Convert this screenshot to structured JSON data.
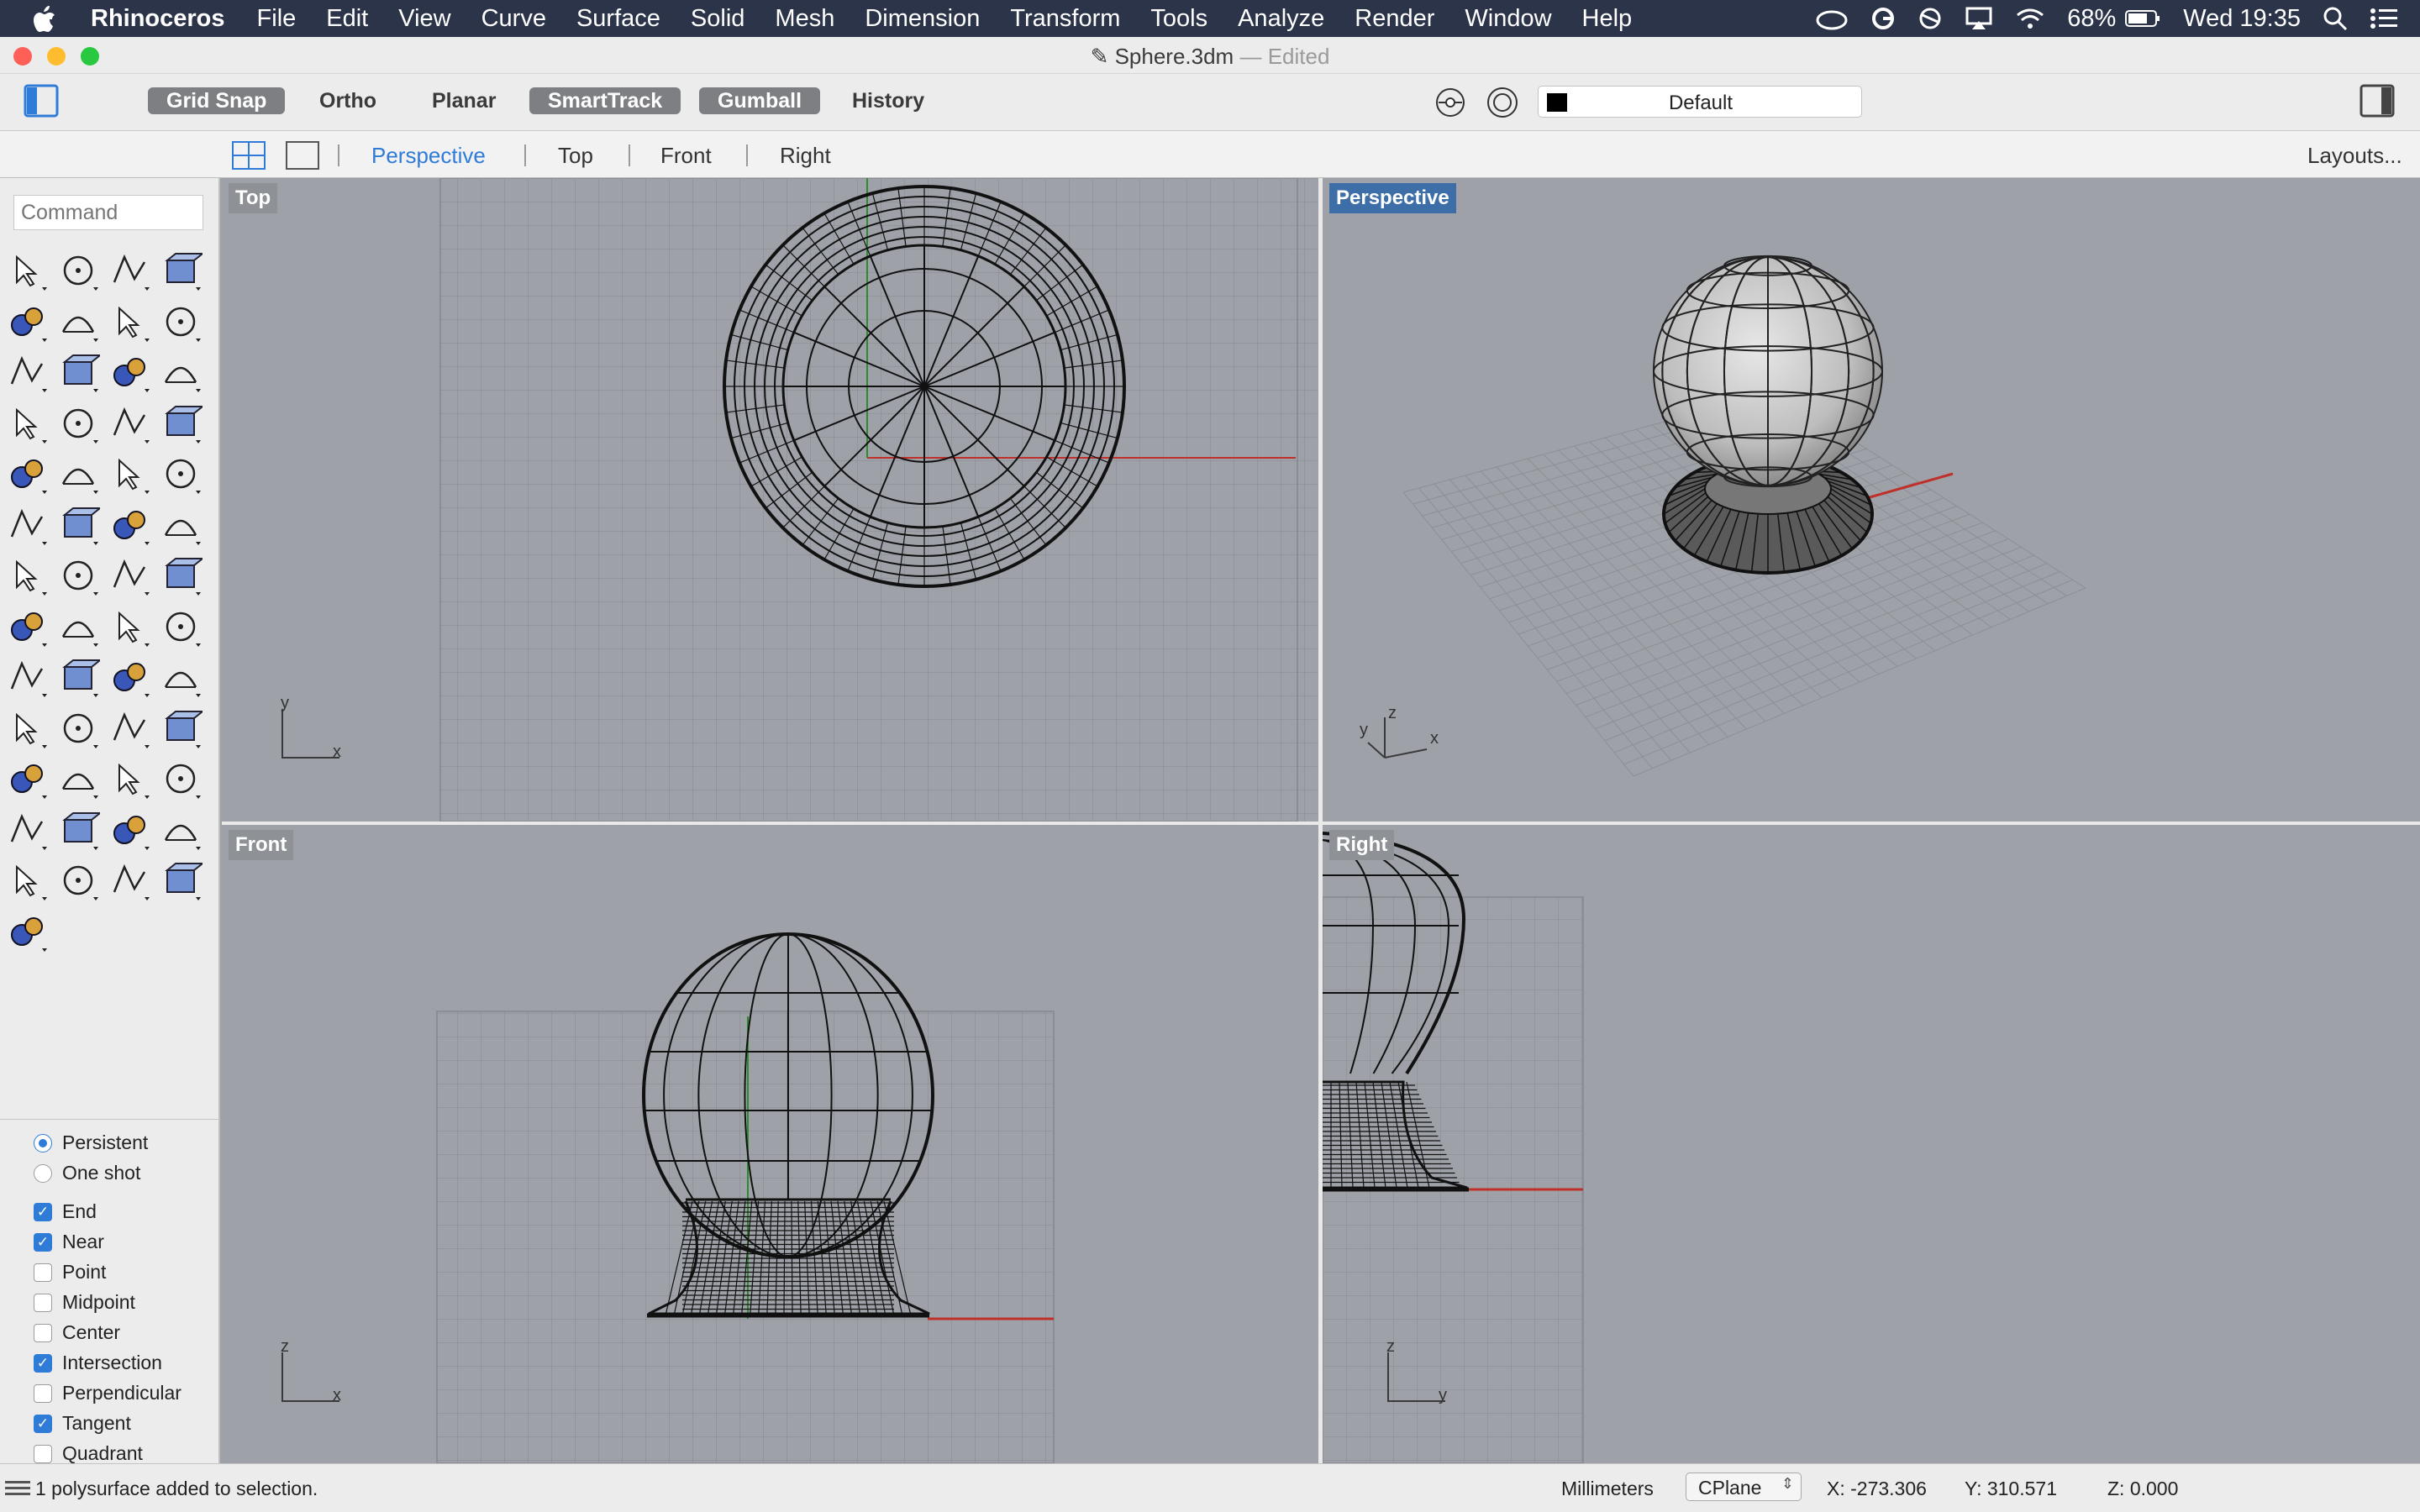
{
  "menubar": {
    "app_name": "Rhinoceros",
    "items": [
      "File",
      "Edit",
      "View",
      "Curve",
      "Surface",
      "Solid",
      "Mesh",
      "Dimension",
      "Transform",
      "Tools",
      "Analyze",
      "Render",
      "Window",
      "Help"
    ],
    "battery": "68%",
    "clock": "Wed 19:35"
  },
  "window": {
    "title": "Sphere.3dm",
    "edited": "— Edited"
  },
  "toolbar": {
    "buttons": [
      {
        "label": "Grid Snap",
        "on": true
      },
      {
        "label": "Ortho",
        "on": false
      },
      {
        "label": "Planar",
        "on": false
      },
      {
        "label": "SmartTrack",
        "on": true
      },
      {
        "label": "Gumball",
        "on": true
      },
      {
        "label": "History",
        "on": false
      }
    ],
    "layer": "Default"
  },
  "tabs": {
    "items": [
      "Perspective",
      "Top",
      "Front",
      "Right"
    ],
    "active": "Perspective",
    "layouts": "Layouts..."
  },
  "command": {
    "placeholder": "Command"
  },
  "osnap": {
    "modes": [
      {
        "label": "Persistent",
        "on": true
      },
      {
        "label": "One shot",
        "on": false
      }
    ],
    "snaps": [
      {
        "label": "End",
        "on": true
      },
      {
        "label": "Near",
        "on": true
      },
      {
        "label": "Point",
        "on": false
      },
      {
        "label": "Midpoint",
        "on": false
      },
      {
        "label": "Center",
        "on": false
      },
      {
        "label": "Intersection",
        "on": true
      },
      {
        "label": "Perpendicular",
        "on": false
      },
      {
        "label": "Tangent",
        "on": true
      },
      {
        "label": "Quadrant",
        "on": false
      }
    ]
  },
  "viewports": {
    "top": "Top",
    "perspective": "Perspective",
    "front": "Front",
    "right": "Right",
    "axis_x": "x",
    "axis_y": "y",
    "axis_z": "z"
  },
  "status": {
    "message": "1 polysurface added to selection.",
    "units": "Millimeters",
    "cplane": "CPlane",
    "x": "X: -273.306",
    "y": "Y: 310.571",
    "z": "Z: 0.000"
  },
  "colors": {
    "accent": "#2f7bd8",
    "menubar": "#2b3448",
    "viewport_bg": "#9ea2a8",
    "x_axis": "#c0302a",
    "y_axis": "#2e8a2e"
  }
}
